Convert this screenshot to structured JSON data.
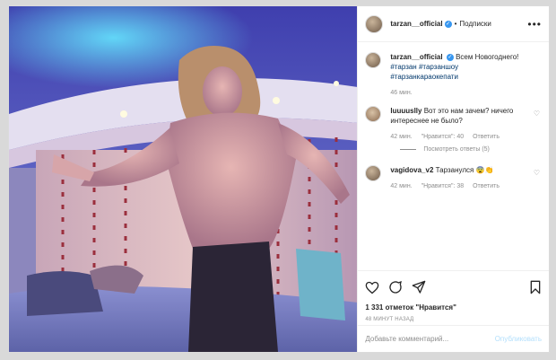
{
  "post": {
    "author": "tarzan__official",
    "follow_label": "Подписки",
    "dot": "•",
    "more": "•••",
    "verified_glyph": "✓"
  },
  "caption": {
    "user": "tarzan__official",
    "text": "Всем Новогоднего!",
    "hashtags": [
      "#тарзан #тарзаншоу",
      "#тарзанкараокепати"
    ],
    "time": "46 мин."
  },
  "comments": [
    {
      "user": "luuuuslly",
      "text": "Вот это нам зачем? ничего интереснее не было?",
      "time": "42 мин.",
      "likes": "\"Нравится\": 40",
      "reply": "Ответить",
      "view_replies": "Посмотреть ответы (5)"
    },
    {
      "user": "vagidova_v2",
      "text": "Тарзанулся 😨👏",
      "time": "42 мин.",
      "likes": "\"Нравится\": 38",
      "reply": "Ответить"
    }
  ],
  "likes_text": "1 331 отметок \"Нравится\"",
  "posted_ago": "48 минут назад",
  "comment_input": {
    "placeholder": "Добавьте комментарий...",
    "publish_label": "Опубликовать"
  },
  "icons": [
    "heart-icon",
    "comment-icon",
    "share-icon",
    "bookmark-icon",
    "more-icon",
    "verified-icon"
  ],
  "colors": {
    "accent": "#3897f0",
    "link": "#00376b",
    "muted": "#8e8e8e",
    "publish_disabled": "#b2dffc"
  }
}
